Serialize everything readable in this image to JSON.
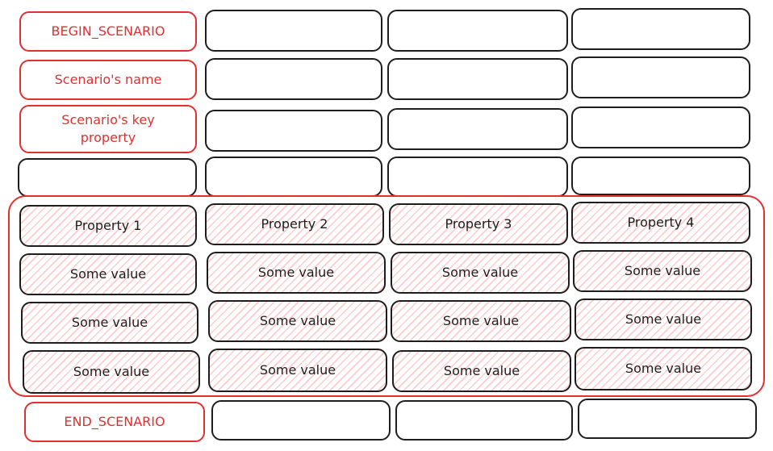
{
  "header_labels": {
    "begin": "BEGIN_SCENARIO",
    "name": "Scenario's name",
    "key_property": "Scenario's key property",
    "end": "END_SCENARIO"
  },
  "table": {
    "headers": [
      "Property 1",
      "Property 2",
      "Property 3",
      "Property 4"
    ],
    "rows": [
      [
        "Some value",
        "Some value",
        "Some value",
        "Some value"
      ],
      [
        "Some value",
        "Some value",
        "Some value",
        "Some value"
      ],
      [
        "Some value",
        "Some value",
        "Some value",
        "Some value"
      ]
    ]
  },
  "colors": {
    "accent_red": "#e03131",
    "stroke": "#1e1e1e",
    "hatch_fill": "#ffc9c9"
  }
}
